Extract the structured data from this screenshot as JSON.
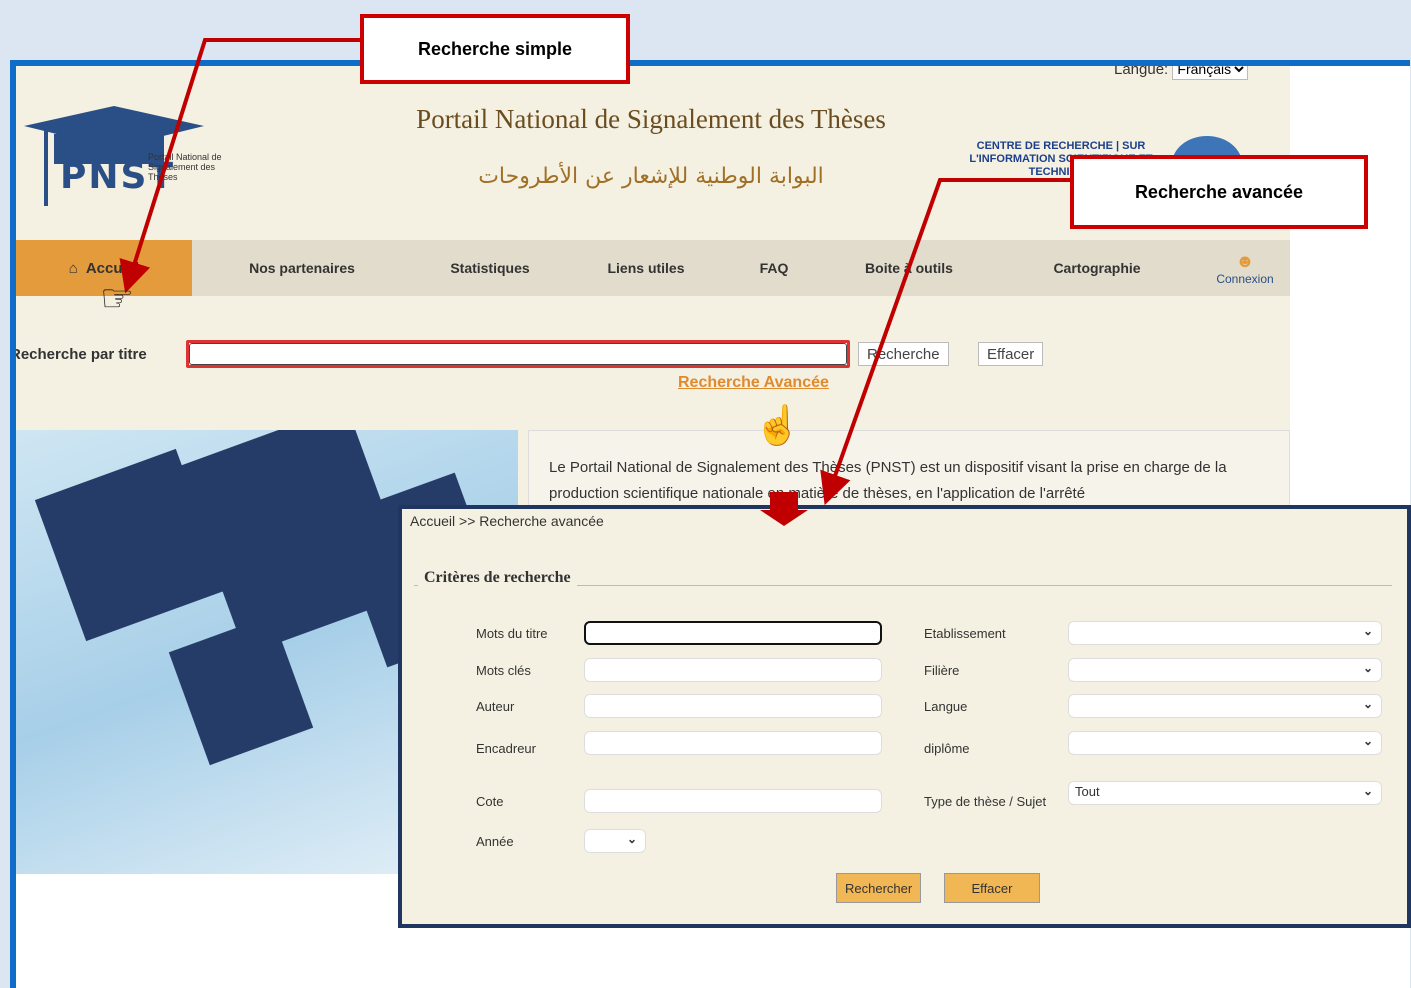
{
  "header": {
    "lang_label": "Langue:",
    "lang_value": "Français",
    "title_fr": "Portail National de Signalement des Thèses",
    "title_ar": "البوابة الوطنية للإشعار عن الأطروحات",
    "logo_text": "PNST",
    "logo_sub": "Portail National de Signalement des Thèses",
    "partner": "CENTRE DE RECHERCHE | SUR L'INFORMATION SCIENTIFIQUE ET TECHNIQUE"
  },
  "nav": {
    "home": "Accueil",
    "items": [
      "Nos partenaires",
      "Statistiques",
      "Liens utiles",
      "FAQ",
      "Boite à outils",
      "Cartographie"
    ],
    "connexion": "Connexion"
  },
  "search": {
    "label": "Recherche par titre",
    "button": "Recherche",
    "clear": "Effacer",
    "advanced_link": "Recherche Avancée"
  },
  "description": "Le Portail National de Signalement des Thèses (PNST) est un dispositif visant la prise en charge de la production scientifique nationale en matière de thèses, en l'application de l'arrêté",
  "advanced": {
    "breadcrumb": "Accueil >> Recherche avancée",
    "legend": "Critères de recherche",
    "left_fields": [
      "Mots du titre",
      "Mots clés",
      "Auteur",
      "Encadreur",
      "Cote"
    ],
    "year_label": "Année",
    "right_fields": [
      "Etablissement",
      "Filière",
      "Langue",
      "diplôme",
      "Type de thèse / Sujet"
    ],
    "type_value": "Tout",
    "search_button": "Rechercher",
    "clear_button": "Effacer"
  },
  "callouts": {
    "simple": "Recherche simple",
    "advanced": "Recherche avancée"
  },
  "colors": {
    "accent": "#e39b3b",
    "callout": "#c00000",
    "frame": "#0f6cc7"
  }
}
